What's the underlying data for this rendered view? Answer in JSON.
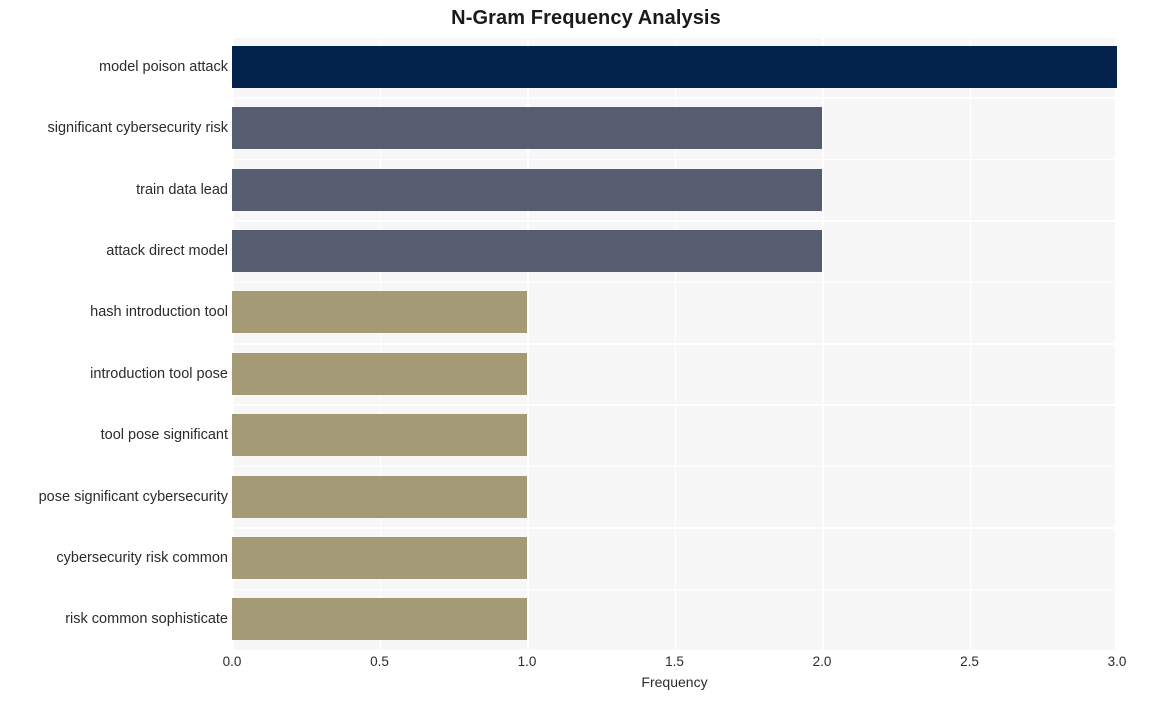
{
  "chart_data": {
    "type": "bar",
    "orientation": "horizontal",
    "title": "N-Gram Frequency Analysis",
    "xlabel": "Frequency",
    "ylabel": "",
    "xlim": [
      0,
      3.0
    ],
    "grid": true,
    "legend": "none",
    "xticks": [
      "0.0",
      "0.5",
      "1.0",
      "1.5",
      "2.0",
      "2.5",
      "3.0"
    ],
    "xtick_values": [
      0,
      0.5,
      1,
      1.5,
      2,
      2.5,
      3
    ],
    "categories": [
      "model poison attack",
      "significant cybersecurity risk",
      "train data lead",
      "attack direct model",
      "hash introduction tool",
      "introduction tool pose",
      "tool pose significant",
      "pose significant cybersecurity",
      "cybersecurity risk common",
      "risk common sophisticate"
    ],
    "values": [
      3,
      2,
      2,
      2,
      1,
      1,
      1,
      1,
      1,
      1
    ],
    "bar_colors": [
      "#03234c",
      "#575d70",
      "#575d70",
      "#575d70",
      "#a49b76",
      "#a49b76",
      "#a49b76",
      "#a49b76",
      "#a49b76",
      "#a49b76"
    ]
  },
  "style": {
    "figure_background": "#ffffff",
    "plot_background": "#f7f7f8",
    "gridline_color": "#ffffff",
    "text_color": "#2b2b2b",
    "title_color": "#1a1a1a"
  }
}
